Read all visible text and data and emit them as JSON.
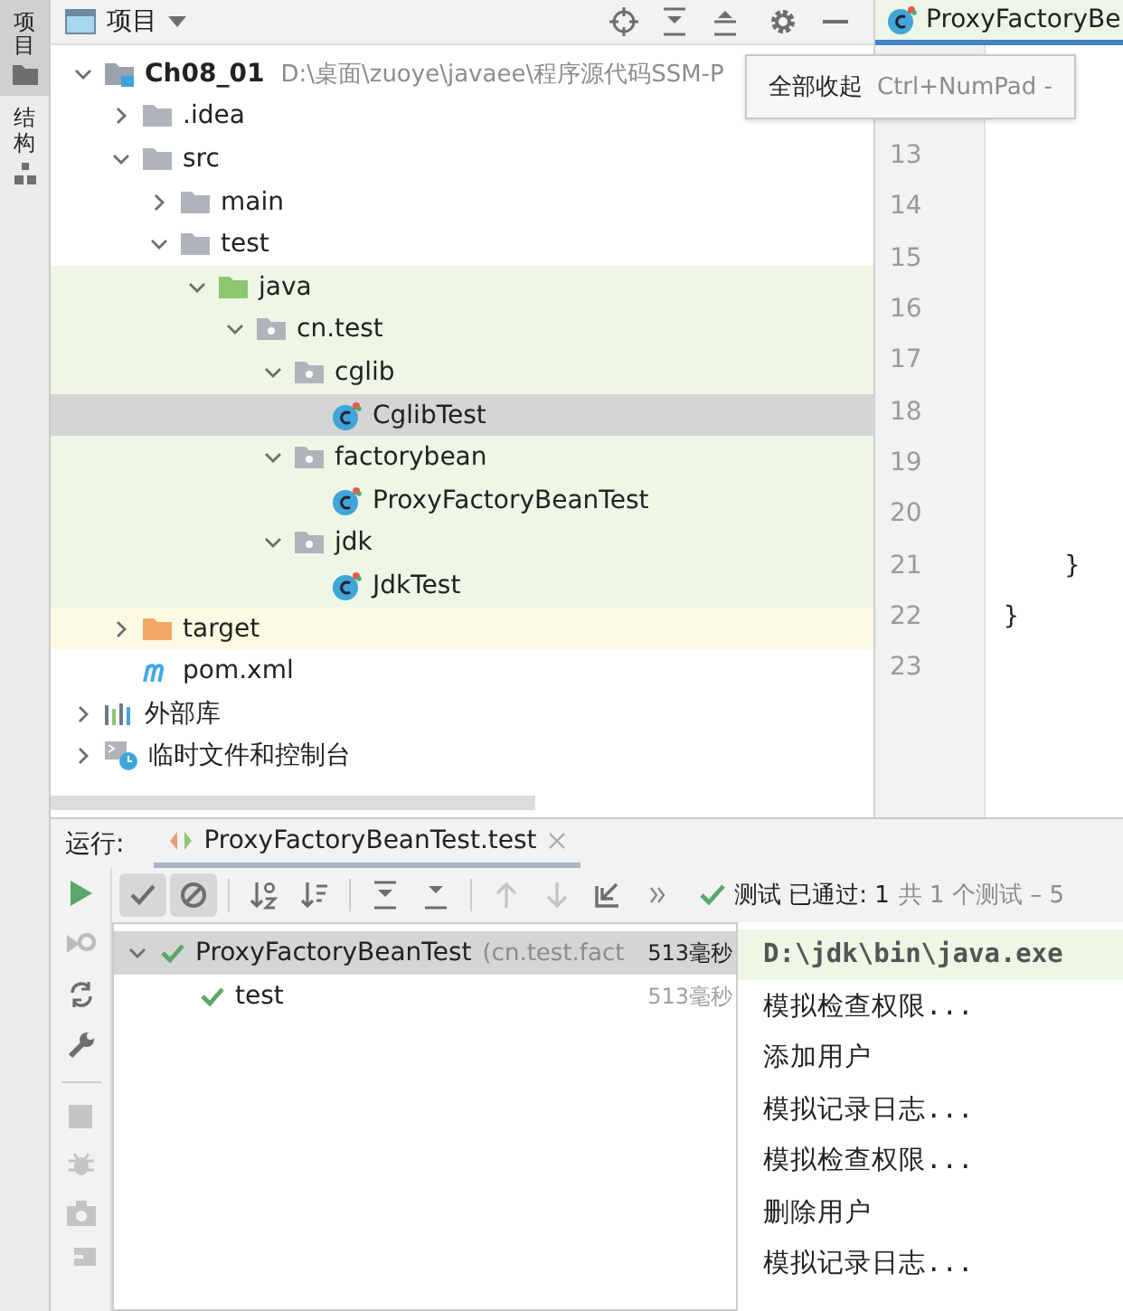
{
  "side_tabs": [
    {
      "label": "项目",
      "selected": true,
      "kind": "project"
    },
    {
      "label": "结构",
      "selected": false,
      "kind": "structure"
    }
  ],
  "project_panel": {
    "title": "项目",
    "tree": [
      {
        "label": "Ch08_01",
        "path": "D:\\桌面\\zuoye\\javaee\\程序源代码SSM-P",
        "kind": "module",
        "expanded": true,
        "selected": false,
        "children": [
          {
            "label": ".idea",
            "kind": "folder",
            "expanded": false,
            "selected": false
          },
          {
            "label": "src",
            "kind": "folder",
            "expanded": true,
            "selected": false,
            "children": [
              {
                "label": "main",
                "kind": "folder",
                "expanded": false,
                "selected": false
              },
              {
                "label": "test",
                "kind": "folder",
                "expanded": true,
                "selected": false,
                "children": [
                  {
                    "label": "java",
                    "kind": "test-root",
                    "expanded": true,
                    "selected": false,
                    "children": [
                      {
                        "label": "cn.test",
                        "kind": "package",
                        "expanded": true,
                        "selected": false,
                        "children": [
                          {
                            "label": "cglib",
                            "kind": "package",
                            "expanded": true,
                            "selected": false,
                            "children": [
                              {
                                "label": "CglibTest",
                                "kind": "class",
                                "selected": true
                              }
                            ]
                          },
                          {
                            "label": "factorybean",
                            "kind": "package",
                            "expanded": true,
                            "selected": false,
                            "children": [
                              {
                                "label": "ProxyFactoryBeanTest",
                                "kind": "class",
                                "selected": false
                              }
                            ]
                          },
                          {
                            "label": "jdk",
                            "kind": "package",
                            "expanded": true,
                            "selected": false,
                            "children": [
                              {
                                "label": "JdkTest",
                                "kind": "class",
                                "selected": false
                              }
                            ]
                          }
                        ]
                      }
                    ]
                  }
                ]
              }
            ]
          },
          {
            "label": "target",
            "kind": "excluded",
            "expanded": false,
            "selected": false
          },
          {
            "label": "pom.xml",
            "kind": "maven",
            "selected": false
          }
        ]
      },
      {
        "label": "外部库",
        "kind": "libraries",
        "expanded": false,
        "selected": false
      },
      {
        "label": "临时文件和控制台",
        "kind": "scratches",
        "expanded": false,
        "selected": false
      }
    ]
  },
  "tooltip": {
    "action": "全部收起",
    "shortcut": "Ctrl+NumPad -"
  },
  "editor": {
    "tab": "ProxyFactoryBe",
    "lines": [
      {
        "number": "13"
      },
      {
        "number": "14"
      },
      {
        "number": "15"
      },
      {
        "number": "16"
      },
      {
        "number": "17"
      },
      {
        "number": "18"
      },
      {
        "number": "19"
      },
      {
        "number": "20"
      },
      {
        "number": "21",
        "code": "    }"
      },
      {
        "number": "22",
        "code": "}"
      },
      {
        "number": "23"
      }
    ]
  },
  "run_panel": {
    "label": "运行:",
    "tab": "ProxyFactoryBeanTest.test",
    "filters": [
      {
        "kind": "passed",
        "selected": true
      },
      {
        "kind": "ignored",
        "selected": true
      }
    ],
    "status": "测试 已通过: 1",
    "status_detail": "共 1 个测试 – 5",
    "tests": [
      {
        "label": "ProxyFactoryBeanTest",
        "package": "(cn.test.fact",
        "time": "513毫秒",
        "passed": true,
        "expanded": true,
        "selected": true,
        "children": [
          {
            "label": "test",
            "time": "513毫秒",
            "passed": true,
            "selected": false
          }
        ]
      }
    ],
    "console": [
      {
        "text": "D:\\jdk\\bin\\java.exe",
        "kind": "command"
      },
      {
        "text": "模拟检查权限...",
        "kind": "output"
      },
      {
        "text": "添加用户",
        "kind": "output"
      },
      {
        "text": "模拟记录日志...",
        "kind": "output"
      },
      {
        "text": "模拟检查权限...",
        "kind": "output"
      },
      {
        "text": "删除用户",
        "kind": "output"
      },
      {
        "text": "模拟记录日志...",
        "kind": "output"
      }
    ]
  }
}
